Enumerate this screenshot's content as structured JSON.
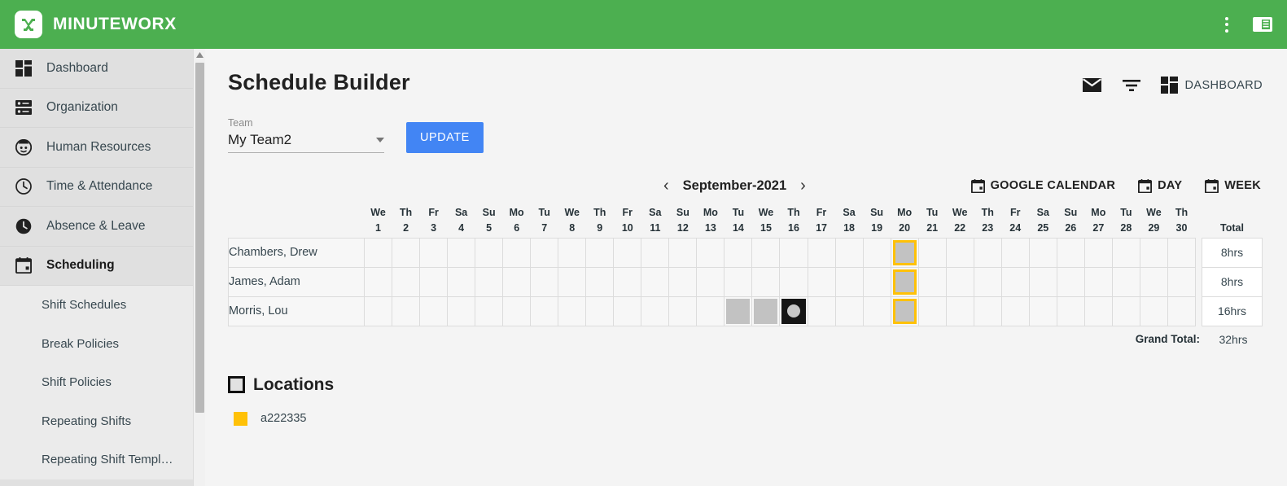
{
  "app": {
    "brand_name": "MINUTEWORX",
    "logo_icon": "minuteworx-logo-icon",
    "overflow_icon": "more-vert-icon",
    "panel_icon": "toggle-panel-icon"
  },
  "sidebar": {
    "items": [
      {
        "label": "Dashboard",
        "icon": "dashboard-grid-icon",
        "active": false
      },
      {
        "label": "Organization",
        "icon": "organization-icon",
        "active": false
      },
      {
        "label": "Human Resources",
        "icon": "person-circle-icon",
        "active": false
      },
      {
        "label": "Time & Attendance",
        "icon": "clock-outline-icon",
        "active": false
      },
      {
        "label": "Absence & Leave",
        "icon": "clock-filled-icon",
        "active": false
      },
      {
        "label": "Scheduling",
        "icon": "calendar-icon",
        "active": true
      }
    ],
    "subitems": [
      {
        "label": "Shift Schedules"
      },
      {
        "label": "Break Policies"
      },
      {
        "label": "Shift Policies"
      },
      {
        "label": "Repeating Shifts"
      },
      {
        "label": "Repeating Shift Templ…"
      }
    ],
    "scrollbar_up_icon": "scroll-up-arrow-icon"
  },
  "header": {
    "title": "Schedule Builder",
    "mail_icon": "mail-icon",
    "filter_icon": "filter-icon",
    "dashboard_icon": "dashboard-grid-icon",
    "dashboard_label": "DASHBOARD"
  },
  "team": {
    "label": "Team",
    "value": "My Team2",
    "dropdown_icon": "chevron-down-icon",
    "update_label": "UPDATE"
  },
  "calendar": {
    "prev_icon": "chevron-left-icon",
    "next_icon": "chevron-right-icon",
    "month": "September-2021",
    "views": [
      {
        "label": "GOOGLE CALENDAR",
        "icon": "calendar-icon"
      },
      {
        "label": "DAY",
        "icon": "calendar-icon"
      },
      {
        "label": "WEEK",
        "icon": "calendar-icon"
      }
    ]
  },
  "schedule": {
    "total_header": "Total",
    "days": [
      {
        "dow": "We",
        "num": "1"
      },
      {
        "dow": "Th",
        "num": "2"
      },
      {
        "dow": "Fr",
        "num": "3"
      },
      {
        "dow": "Sa",
        "num": "4"
      },
      {
        "dow": "Su",
        "num": "5"
      },
      {
        "dow": "Mo",
        "num": "6"
      },
      {
        "dow": "Tu",
        "num": "7"
      },
      {
        "dow": "We",
        "num": "8"
      },
      {
        "dow": "Th",
        "num": "9"
      },
      {
        "dow": "Fr",
        "num": "10"
      },
      {
        "dow": "Sa",
        "num": "11"
      },
      {
        "dow": "Su",
        "num": "12"
      },
      {
        "dow": "Mo",
        "num": "13"
      },
      {
        "dow": "Tu",
        "num": "14"
      },
      {
        "dow": "We",
        "num": "15"
      },
      {
        "dow": "Th",
        "num": "16"
      },
      {
        "dow": "Fr",
        "num": "17"
      },
      {
        "dow": "Sa",
        "num": "18"
      },
      {
        "dow": "Su",
        "num": "19"
      },
      {
        "dow": "Mo",
        "num": "20"
      },
      {
        "dow": "Tu",
        "num": "21"
      },
      {
        "dow": "We",
        "num": "22"
      },
      {
        "dow": "Th",
        "num": "23"
      },
      {
        "dow": "Fr",
        "num": "24"
      },
      {
        "dow": "Sa",
        "num": "25"
      },
      {
        "dow": "Su",
        "num": "26"
      },
      {
        "dow": "Mo",
        "num": "27"
      },
      {
        "dow": "Tu",
        "num": "28"
      },
      {
        "dow": "We",
        "num": "29"
      },
      {
        "dow": "Th",
        "num": "30"
      }
    ],
    "rows": [
      {
        "name": "Chambers, Drew",
        "total": "8hrs",
        "shifts": [
          {
            "day": "20",
            "style": "highlight"
          }
        ]
      },
      {
        "name": "James, Adam",
        "total": "8hrs",
        "shifts": [
          {
            "day": "20",
            "style": "highlight"
          }
        ]
      },
      {
        "name": "Morris, Lou",
        "total": "16hrs",
        "shifts": [
          {
            "day": "14",
            "style": "plain"
          },
          {
            "day": "15",
            "style": "plain"
          },
          {
            "day": "16",
            "style": "selected"
          },
          {
            "day": "20",
            "style": "highlight"
          }
        ]
      }
    ],
    "grand_total_label": "Grand Total:",
    "grand_total_value": "32hrs"
  },
  "locations": {
    "title": "Locations",
    "checkbox_icon": "checkbox-icon",
    "items": [
      {
        "name": "a222335",
        "color": "#FFC107"
      }
    ]
  },
  "colors": {
    "brand_green": "#4CAF50",
    "accent_blue": "#4285F4",
    "location_yellow": "#FFC107",
    "shift_gray": "#C2C2C2",
    "selected_black": "#151515"
  }
}
